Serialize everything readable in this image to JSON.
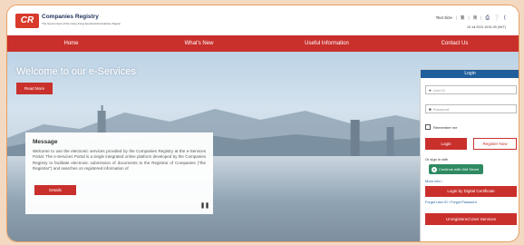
{
  "header": {
    "logo_text": "CR",
    "title": "Companies Registry",
    "subtitle": "The Government of the Hong Kong Special Administrative Region",
    "text_size_label": "Text Size",
    "lang_1": "繁",
    "lang_2": "简",
    "datetime": "15 Jul 2024 15:51:39 (HKT)"
  },
  "nav": {
    "items": [
      "Home",
      "What's New",
      "Useful Information",
      "Contact Us"
    ]
  },
  "hero": {
    "welcome": "Welcome to our e-Services",
    "read_more": "Read More"
  },
  "message": {
    "title": "Message",
    "body": "Welcome to use the electronic services provided by the Companies Registry at the e-Services Portal. The e-Services Portal is a single integrated online platform developed by the Companies Registry to facilitate electronic submission of documents to the Registrar of Companies (\"the Registrar\") and searches on registered information of",
    "details": "Details"
  },
  "login": {
    "title": "Login",
    "user_id_placeholder": "User ID",
    "password_placeholder": "Password",
    "remember_me": "Remember me",
    "login_button": "Login",
    "register_button": "Register Now",
    "or_sign_in": "Or sign in with",
    "iamsmart_button": "Continue with iAM Smart",
    "more_info": "More info ›",
    "digital_cert_button": "Login by Digital Certificate",
    "forgot": "Forgot User ID / Forgot Password",
    "unregistered_button": "Unregistered User Services"
  },
  "colors": {
    "brand_red": "#c9302c",
    "login_header_blue": "#1f5f9c",
    "iamsmart_green": "#2f8a63",
    "frame_orange": "#e7a064"
  }
}
